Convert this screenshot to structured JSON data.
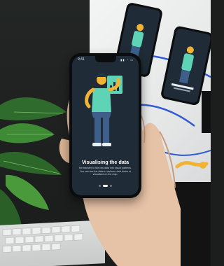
{
  "phone": {
    "status_time": "9:41",
    "status_icons": "▮▮ ◔ ▭",
    "title": "Visualising the data",
    "description": "the transfer to the raw data into visual patterns. You can see the data in various chart forms or visualised on the map.",
    "page_indicator": {
      "count": 3,
      "active": 1
    }
  },
  "colors": {
    "screen_bg": "#1f2b36",
    "accent_yellow": "#f2b233",
    "accent_teal": "#5fd3b6",
    "figure_blue": "#3d5f8a",
    "wire_blue": "#2f5bd3"
  },
  "icons": [
    "person-illustration-icon",
    "chart-icon",
    "plant-leaf-icon"
  ]
}
